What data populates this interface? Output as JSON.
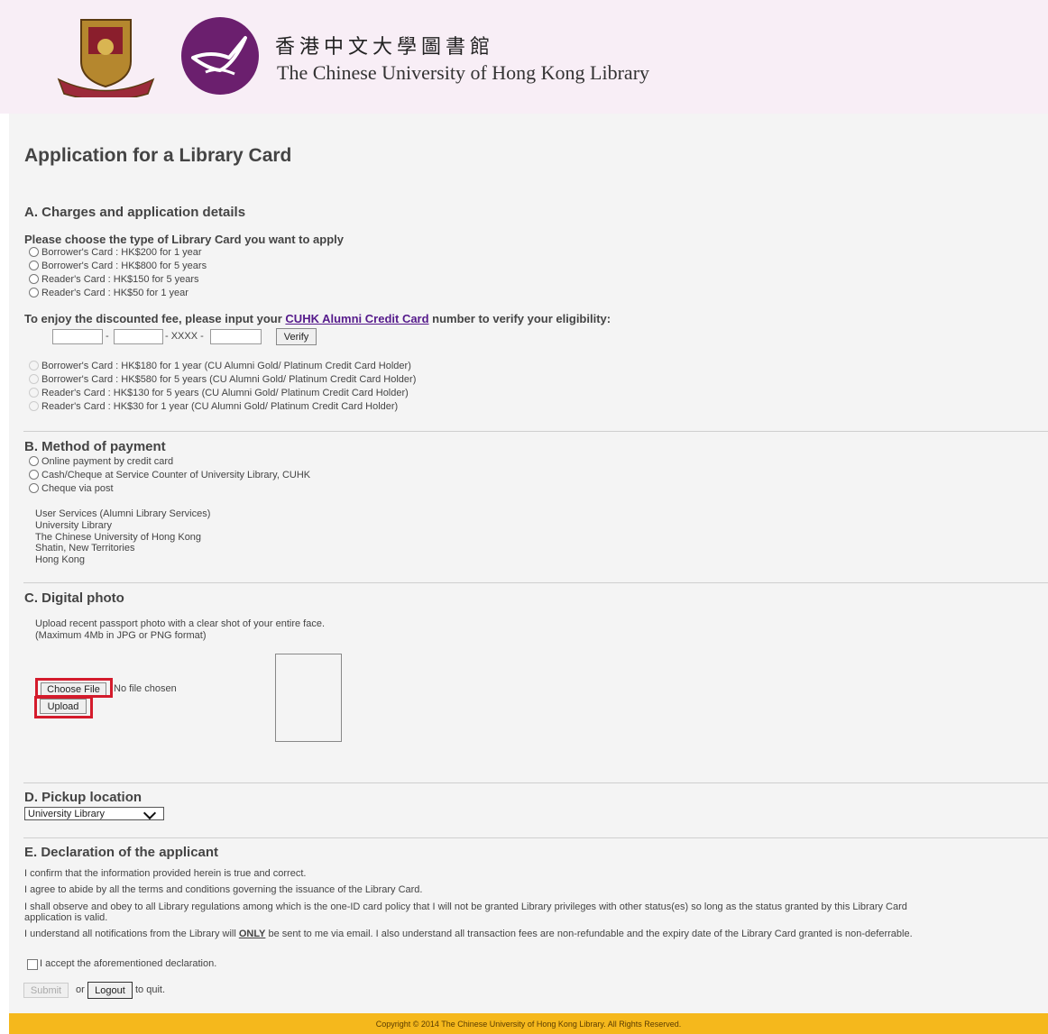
{
  "header": {
    "library_name_zh": "香港中文大學圖書館",
    "library_name_en": "The Chinese University of Hong Kong Library",
    "crest_icon": "cuhk-crest-icon",
    "library_logo_icon": "library-bird-logo-icon",
    "brand_color": "#6b1f6e"
  },
  "form": {
    "title": "Application for a Library Card",
    "section_a": {
      "title": "A. Charges and application details",
      "question": "Please choose the type of Library Card you want to apply",
      "options": [
        "Borrower's Card : HK$200 for 1 year",
        "Borrower's Card : HK$800 for 5 years",
        "Reader's Card : HK$150 for 5 years",
        "Reader's Card : HK$50 for 1 year"
      ],
      "discount_prefix": "To enjoy the discounted fee, please input your ",
      "discount_link": "CUHK Alumni Credit Card",
      "discount_suffix": " number to verify your eligibility:",
      "card_sep1": "-",
      "card_sep2": "- XXXX -",
      "verify_label": "Verify",
      "discount_options": [
        "Borrower's Card : HK$180 for 1 year (CU Alumni Gold/ Platinum Credit Card Holder)",
        "Borrower's Card : HK$580 for 5 years (CU Alumni Gold/ Platinum Credit Card Holder)",
        "Reader's Card : HK$130 for 5 years (CU Alumni Gold/ Platinum Credit Card Holder)",
        "Reader's Card : HK$30 for 1 year (CU Alumni Gold/ Platinum Credit Card Holder)"
      ]
    },
    "section_b": {
      "title": "B. Method of payment",
      "options": [
        "Online payment by credit card",
        "Cash/Cheque at Service Counter of University Library, CUHK",
        "Cheque via post"
      ],
      "address": [
        "User Services (Alumni Library Services)",
        "University Library",
        "The Chinese University of Hong Kong",
        "Shatin, New Territories",
        "Hong Kong"
      ]
    },
    "section_c": {
      "title": "C. Digital photo",
      "instructions": [
        "Upload recent passport photo with a clear shot of your entire face.",
        "(Maximum 4Mb in JPG or PNG format)"
      ],
      "choose_file_label": "Choose File",
      "no_file_text": "No file chosen",
      "upload_label": "Upload",
      "highlight_color": "#d41b2c"
    },
    "section_d": {
      "title": "D. Pickup location",
      "selected_location": "University Library"
    },
    "section_e": {
      "title": "E. Declaration of the applicant",
      "lines": [
        "I confirm that the information provided herein is true and correct.",
        "I agree to abide by all the terms and conditions governing the issuance of the Library Card.",
        "I shall observe and obey to all Library regulations among which is the one-ID card policy that I will not be granted Library privileges with other status(es) so long as the status granted by this Library Card",
        "application is valid."
      ],
      "notify_prefix": "I understand all notifications from the Library will ",
      "notify_emphasis": "ONLY",
      "notify_suffix": " be sent to me via email. I also understand all transaction fees are non-refundable and the expiry date of the Library Card granted is non-deferrable.",
      "accept_label": "I accept the aforementioned declaration."
    },
    "actions": {
      "submit_label": "Submit",
      "or_text": "or",
      "logout_label": "Logout",
      "quit_text": "to quit."
    }
  },
  "footer": {
    "copyright": "Copyright © 2014 The Chinese University of Hong Kong Library. All Rights Reserved.",
    "bar_color": "#f5b81c"
  }
}
